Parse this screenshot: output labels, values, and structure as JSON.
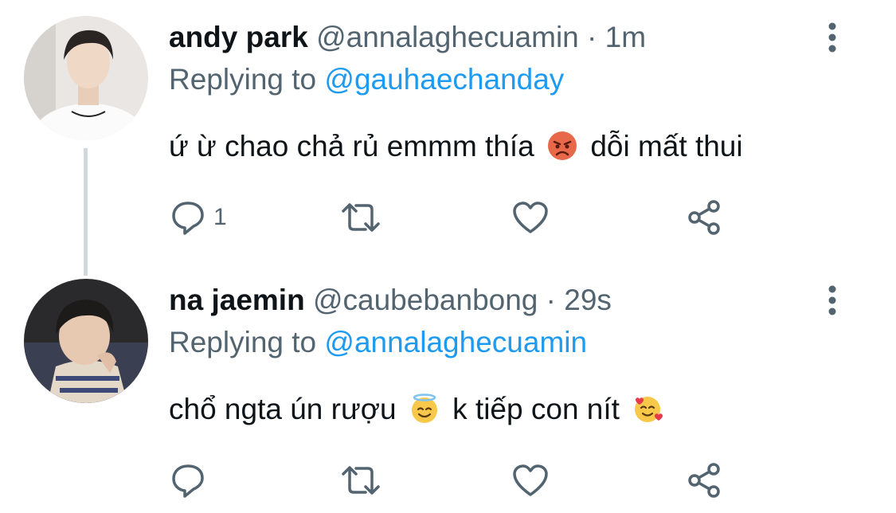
{
  "tweets": [
    {
      "name": "andy park",
      "handle": "@annalaghecuamin",
      "sep": "·",
      "time": "1m",
      "replying_prefix": "Replying to",
      "replying_handle": "@gauhaechanday",
      "text_before_emoji": "ứ ừ chao chả rủ emmm thía",
      "emoji_1": "pouting-face-emoji",
      "text_after_emoji": "dỗi mất thui",
      "reply_count": "1",
      "avatar": "andy-park-avatar"
    },
    {
      "name": "na jaemin",
      "handle": "@caubebanbong",
      "sep": "·",
      "time": "29s",
      "replying_prefix": "Replying to",
      "replying_handle": "@annalaghecuamin",
      "text_before_emoji": "chổ ngta ún rượu",
      "emoji_1": "smiling-face-with-halo-emoji",
      "text_middle": "k tiếp con nít",
      "emoji_2": "smiling-face-with-hearts-emoji",
      "reply_count": "",
      "avatar": "na-jaemin-avatar"
    }
  ],
  "colors": {
    "text": "#0f1419",
    "muted": "#536471",
    "link": "#1d9bf0",
    "thread_line": "#cfd9de"
  },
  "icons": [
    "reply-icon",
    "retweet-icon",
    "like-icon",
    "share-icon",
    "more-icon"
  ]
}
